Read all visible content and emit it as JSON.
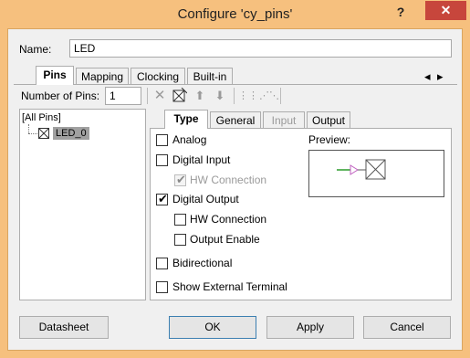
{
  "window": {
    "title": "Configure 'cy_pins'",
    "help_glyph": "?",
    "close_glyph": "✕"
  },
  "name_field": {
    "label": "Name:",
    "value": "LED"
  },
  "top_tabs": [
    {
      "label": "Pins",
      "selected": true
    },
    {
      "label": "Mapping",
      "selected": false
    },
    {
      "label": "Clocking",
      "selected": false
    },
    {
      "label": "Built-in",
      "selected": false
    }
  ],
  "tab_scroll": {
    "left": "◂",
    "right": "▸"
  },
  "number_of_pins": {
    "label": "Number of Pins:",
    "value": "1"
  },
  "tree": {
    "root": "[All Pins]",
    "items": [
      {
        "label": "LED_0"
      }
    ]
  },
  "sub_tabs": [
    {
      "label": "Type",
      "selected": true,
      "disabled": false
    },
    {
      "label": "General",
      "selected": false,
      "disabled": false
    },
    {
      "label": "Input",
      "selected": false,
      "disabled": true
    },
    {
      "label": "Output",
      "selected": false,
      "disabled": false
    }
  ],
  "type_options": {
    "analog": "Analog",
    "digital_input": "Digital Input",
    "hw_connection_in": "HW Connection",
    "digital_output": "Digital Output",
    "hw_connection_out": "HW Connection",
    "output_enable": "Output Enable",
    "bidirectional": "Bidirectional",
    "show_external_terminal": "Show External Terminal",
    "check_glyph": "✔"
  },
  "preview": {
    "label": "Preview:"
  },
  "buttons": {
    "datasheet": "Datasheet",
    "ok": "OK",
    "apply": "Apply",
    "cancel": "Cancel"
  }
}
